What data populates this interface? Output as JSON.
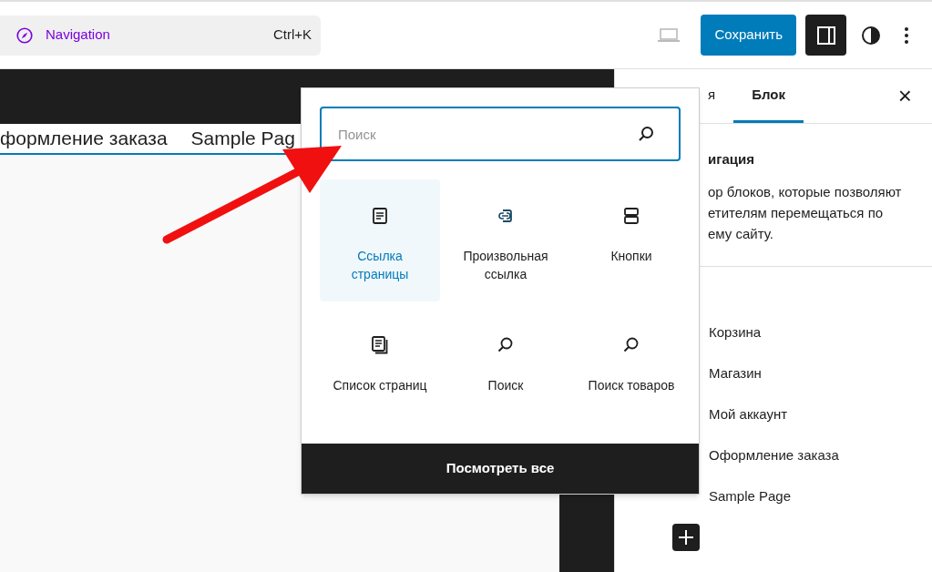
{
  "command_bar": {
    "label": "Navigation",
    "shortcut": "Ctrl+K"
  },
  "toolbar": {
    "save": "Сохранить",
    "sidebar_open": true
  },
  "canvas": {
    "nav_items": [
      "формление заказа",
      "Sample Pag"
    ]
  },
  "sidebar": {
    "tabs": [
      {
        "label": "я",
        "selected": false
      },
      {
        "label": "Блок",
        "selected": true
      }
    ],
    "close": "×",
    "block_title": "игация",
    "block_description": [
      "ор блоков, которые позволяют",
      "етителям перемещаться по",
      "ему сайту."
    ],
    "items": [
      "Корзина",
      "Магазин",
      "Мой аккаунт",
      "Оформление заказа",
      "Sample Page"
    ]
  },
  "inserter": {
    "search": {
      "placeholder": "Поиск"
    },
    "blocks": [
      {
        "kind": "page",
        "label": "Ссылка страницы",
        "selected": true
      },
      {
        "kind": "link",
        "label": "Произвольная ссылка",
        "selected": false
      },
      {
        "kind": "buttons",
        "label": "Кнопки",
        "selected": false
      },
      {
        "kind": "page-list",
        "label": "Список страниц",
        "selected": false
      },
      {
        "kind": "search",
        "label": "Поиск",
        "selected": false
      },
      {
        "kind": "search",
        "label": "Поиск товаров",
        "selected": false
      }
    ],
    "browse_all": "Посмотреть все"
  }
}
